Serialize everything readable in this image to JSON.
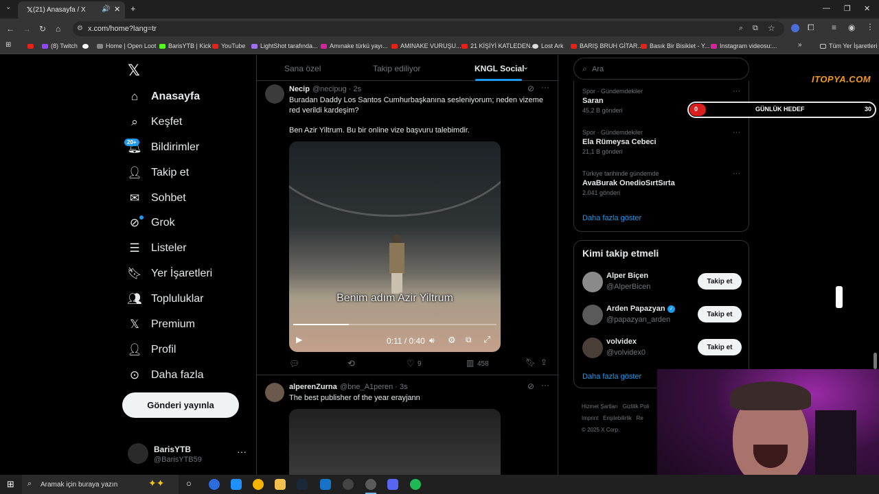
{
  "browser": {
    "tab_title": "(21) Anasayfa / X",
    "url": "x.com/home?lang=tr",
    "bookmarks": [
      "(8) Twitch",
      "Home | Open Loot",
      "BarisYTB | Kick",
      "YouTube",
      "LightShot tarafında...",
      "Amınake türkü yayı...",
      "AMINAKE VURUŞU...",
      "21 KİŞİYİ KATLEDEN...",
      "Lost Ark",
      "BARIŞ BRUH GİTAR...",
      "Basık Bir Bisiklet - Y...",
      "Instagram videosu:..."
    ],
    "all_bookmarks": "Tüm Yer İşaretleri"
  },
  "sidebar": {
    "badge": "20+",
    "items": [
      "Anasayfa",
      "Keşfet",
      "Bildirimler",
      "Takip et",
      "Sohbet",
      "Grok",
      "Listeler",
      "Yer İşaretleri",
      "Topluluklar",
      "Premium",
      "Profil",
      "Daha fazla"
    ],
    "post_button": "Gönderi yayınla",
    "account_name": "BarisYTB",
    "account_handle": "@BarisYTB59"
  },
  "feed_tabs": [
    "Sana özel",
    "Takip ediliyor",
    "KNGL Social"
  ],
  "posts": [
    {
      "name": "Necip",
      "meta": "@necipug · 2s",
      "text1": "Buradan Daddy Los Santos Cumhurbaşkanına sesleniyorum; neden vizeme red verildi kardeşim?",
      "text2": "Ben Azir Yiltrum. Bu bir online vize başvuru talebimdir.",
      "video_caption": "Benim adım Azir Yiltrum",
      "video_time": "0:11 / 0:40",
      "video_progress": 0.275,
      "likes": "9",
      "views": "458"
    },
    {
      "name": "alperenZurna",
      "meta": "@bne_A1peren · 3s",
      "text1": "The best publisher of the year erayjann"
    }
  ],
  "search_placeholder": "Ara",
  "trends": [
    {
      "category": "Spor · Gündemdekiler",
      "name": "Saran",
      "count": "45,2 B gönderi"
    },
    {
      "category": "Spor · Gündemdekiler",
      "name": "Ela Rümeysa Cebeci",
      "count": "21,1 B gönderi"
    },
    {
      "category": "Türkiye tarihinde gündemde",
      "name": "AvaBurak OnedioSırtSırta",
      "count": "2.041 gönderi"
    }
  ],
  "show_more": "Daha fazla göster",
  "who_to_follow": {
    "title": "Kimi takip etmeli",
    "users": [
      {
        "name": "Alper Biçen",
        "handle": "@AlperBicen",
        "verified": false
      },
      {
        "name": "Arden Papazyan",
        "handle": "@papazyan_arden",
        "verified": true
      },
      {
        "name": "volvidex",
        "handle": "@volvidex0",
        "verified": false
      }
    ],
    "follow_label": "Takip et",
    "show_more": "Daha fazla göster"
  },
  "footer": {
    "links": [
      "Hizmet Şartları",
      "Gizlilik Poli",
      "Imprint",
      "Erişilebilirlik",
      "Re"
    ],
    "copyright": "© 2025 X Corp."
  },
  "overlay": {
    "logo_text": "ITOPYA.COM",
    "goal_label": "GÜNLÜK HEDEF",
    "goal_current": "0",
    "goal_target": "30"
  },
  "taskbar": {
    "search_placeholder": "Aramak için buraya yazın"
  },
  "colors": {
    "accent": "#1d9bf0",
    "background": "#000000",
    "border": "#2f3336"
  }
}
